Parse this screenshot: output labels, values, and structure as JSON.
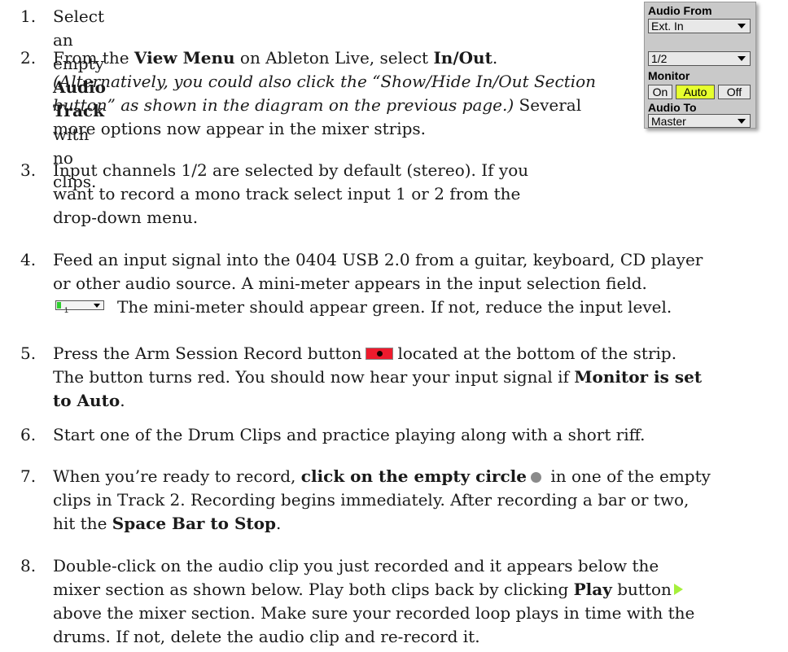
{
  "panel": {
    "audio_from_label": "Audio From",
    "audio_from_value": "Ext. In",
    "channel_value": "1/2",
    "monitor_label": "Monitor",
    "monitor_options": [
      "On",
      "Auto",
      "Off"
    ],
    "monitor_selected": "Auto",
    "audio_to_label": "Audio To",
    "audio_to_value": "Master"
  },
  "mini_meter": {
    "label": "1",
    "color": "#2fcf2f"
  },
  "colors": {
    "arm_button": "#ee1b2d",
    "monitor_active": "#e6ff2e",
    "play_icon": "#a6f03c"
  },
  "steps": [
    {
      "num": "1.",
      "a": "Select an empty ",
      "b": "Audio Track",
      "c": " with no clips."
    },
    {
      "num": "2.",
      "a": "From the ",
      "b": "View Menu",
      "c": " on Ableton Live, select ",
      "d": "In/Out",
      "e": ".",
      "i1": "(Alternatively, you could also click the “Show/Hide In/Out Section",
      "i2": "button” as shown in the diagram on the previous page.)",
      "f": " Several",
      "g": "more options now appear in the mixer strips."
    },
    {
      "num": "3.",
      "l1": "Input channels 1/2 are selected by default (stereo). If you",
      "l2": "want to record a mono track select input 1 or 2 from the",
      "l3": "drop-down menu."
    },
    {
      "num": "4.",
      "l1": "Feed an input signal into the 0404 USB 2.0 from a guitar, keyboard, CD player",
      "l2": "or other audio source. A mini-meter appears in the input selection field.",
      "l3": "The mini-meter should appear green. If not, reduce the input level."
    },
    {
      "num": "5.",
      "a": "Press the Arm Session Record button",
      "b": "located at the bottom of the strip.",
      "l2": "The button turns red. You should now hear your input signal if ",
      "l2b": "Monitor is set",
      "l3b": "to Auto",
      "l3": "."
    },
    {
      "num": "6.",
      "l1": "Start one of the Drum Clips and practice playing along with a short riff."
    },
    {
      "num": "7.",
      "a": "When you’re ready to record, ",
      "b": "click on the empty circle",
      "c": " in one of the empty",
      "l2": "clips in Track 2. Recording begins immediately. After recording a bar or two,",
      "l3a": "hit the ",
      "l3b": "Space Bar to Stop",
      "l3c": "."
    },
    {
      "num": "8.",
      "l1": "Double-click on the audio clip you just recorded and it appears below the",
      "l2a": "mixer section as shown below. Play both clips back by clicking ",
      "l2b": "Play",
      "l2c": " button",
      "l3": "above the mixer section. Make sure your recorded loop plays in time with the",
      "l4": "drums. If not, delete the audio clip and re-record it."
    }
  ]
}
